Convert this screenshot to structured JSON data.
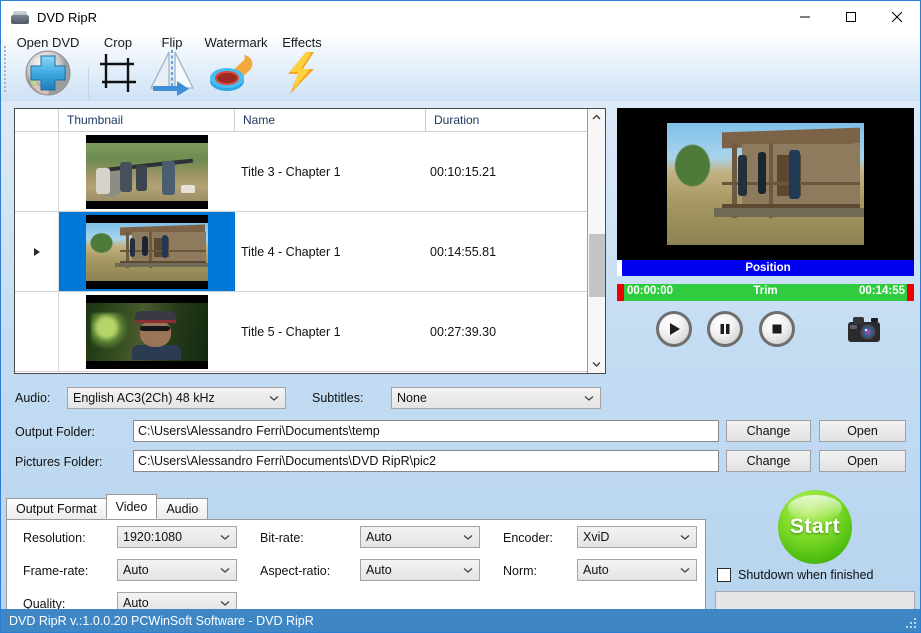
{
  "window": {
    "title": "DVD RipR",
    "icon": "dvd-drive-icon",
    "minimize": "minimize-icon",
    "maximize": "maximize-icon",
    "close": "close-icon"
  },
  "toolbar": {
    "items": [
      {
        "label": "Open DVD",
        "icon": "dvd-plus-icon"
      },
      {
        "label": "Crop",
        "icon": "crop-icon"
      },
      {
        "label": "Flip",
        "icon": "flip-icon"
      },
      {
        "label": "Watermark",
        "icon": "stamp-icon"
      },
      {
        "label": "Effects",
        "icon": "lightning-bolt-icon"
      }
    ]
  },
  "list": {
    "columns": [
      "",
      "Thumbnail",
      "Name",
      "Duration"
    ],
    "rows": [
      {
        "marker": "",
        "name": "Title 3 - Chapter 1",
        "duration": "00:10:15.21",
        "selected": false
      },
      {
        "marker": "▶",
        "name": "Title 4 - Chapter 1",
        "duration": "00:14:55.81",
        "selected": true
      },
      {
        "marker": "",
        "name": "Title 5 - Chapter 1",
        "duration": "00:27:39.30",
        "selected": false
      }
    ]
  },
  "preview": {
    "position_label": "Position",
    "trim_label": "Trim",
    "trim_start": "00:00:00",
    "trim_end": "00:14:55",
    "controls": [
      {
        "name": "play-button",
        "icon": "play-icon"
      },
      {
        "name": "pause-button",
        "icon": "pause-icon"
      },
      {
        "name": "stop-button",
        "icon": "stop-icon"
      },
      {
        "name": "snapshot-button",
        "icon": "camera-icon"
      }
    ]
  },
  "media": {
    "audio_label": "Audio:",
    "audio_value": "English AC3(2Ch) 48 kHz",
    "subtitles_label": "Subtitles:",
    "subtitles_value": "None"
  },
  "folders": {
    "output_label": "Output Folder:",
    "output_value": "C:\\Users\\Alessandro Ferri\\Documents\\temp",
    "pictures_label": "Pictures Folder:",
    "pictures_value": "C:\\Users\\Alessandro Ferri\\Documents\\DVD RipR\\pic2",
    "change_label": "Change",
    "open_label": "Open"
  },
  "tabs": [
    {
      "label": "Output Format",
      "active": false
    },
    {
      "label": "Video",
      "active": true
    },
    {
      "label": "Audio",
      "active": false
    }
  ],
  "video_settings": {
    "fields": [
      {
        "label": "Resolution:",
        "value": "1920:1080"
      },
      {
        "label": "Frame-rate:",
        "value": "Auto"
      },
      {
        "label": "Quality:",
        "value": "Auto"
      },
      {
        "label": "Bit-rate:",
        "value": "Auto"
      },
      {
        "label": "Aspect-ratio:",
        "value": "Auto"
      },
      {
        "label": "Encoder:",
        "value": "XviD"
      },
      {
        "label": "Norm:",
        "value": "Auto"
      }
    ]
  },
  "action": {
    "start_label": "Start",
    "shutdown_label": "Shutdown when finished",
    "shutdown_checked": false,
    "progress_value": ""
  },
  "statusbar": {
    "text": "DVD RipR v.:1.0.0.20 PCWinSoft Software - DVD RipR"
  },
  "colors": {
    "accent_blue": "#3e86c4",
    "selection_blue": "#0078d7",
    "position_blue": "#0000ee",
    "trim_green": "#2ecc3e",
    "trim_handle_red": "#ee0000",
    "start_green": "#84dd2a"
  }
}
